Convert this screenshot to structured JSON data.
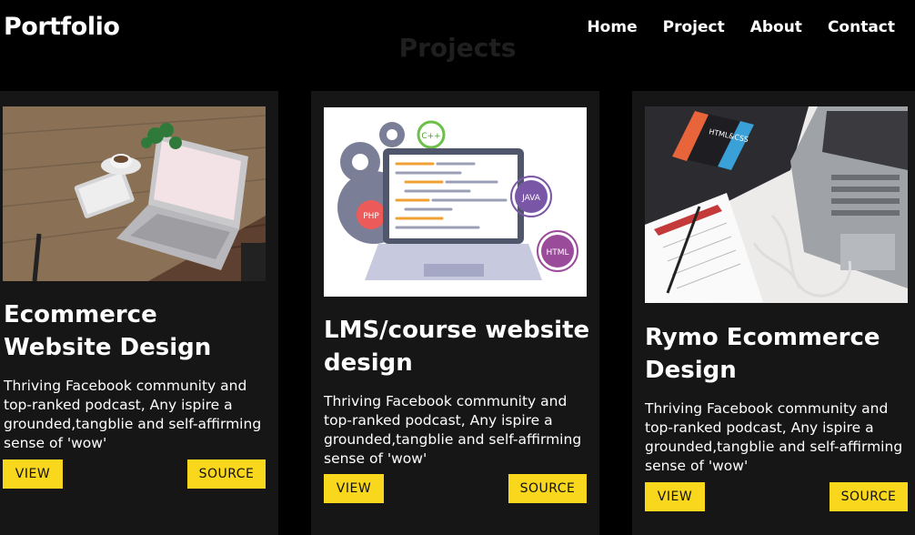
{
  "header": {
    "logo": "Portfolio",
    "nav": [
      "Home",
      "Project",
      "About",
      "Contact"
    ]
  },
  "section": {
    "title": "Projects"
  },
  "projects": [
    {
      "title": "Ecommerce Website Design",
      "description": "Thriving Facebook community and top-ranked podcast, Any ispire a grounded,tangblie and self-affirming sense of 'wow'",
      "view_label": "VIEW",
      "source_label": "SOURCE",
      "image": "laptop-on-wooden-desk"
    },
    {
      "title": "LMS/course website design",
      "description": "Thriving Facebook community and top-ranked podcast, Any ispire a grounded,tangblie and self-affirming sense of 'wow'",
      "view_label": "VIEW",
      "source_label": "SOURCE",
      "image": "coding-laptop-illustration",
      "image_badges": [
        "C++",
        "PHP",
        "JAVA",
        "HTML"
      ]
    },
    {
      "title": "Rymo Ecommerce Design",
      "description": "Thriving Facebook community and top-ranked podcast, Any ispire a grounded,tangblie and self-affirming sense of 'wow'",
      "view_label": "VIEW",
      "source_label": "SOURCE",
      "image": "html-css-book-and-laptop",
      "image_book_label": "HTML&CSS"
    }
  ],
  "colors": {
    "background": "#000000",
    "card": "#161616",
    "button": "#f9d71c",
    "title_muted": "#1f1f1f"
  }
}
